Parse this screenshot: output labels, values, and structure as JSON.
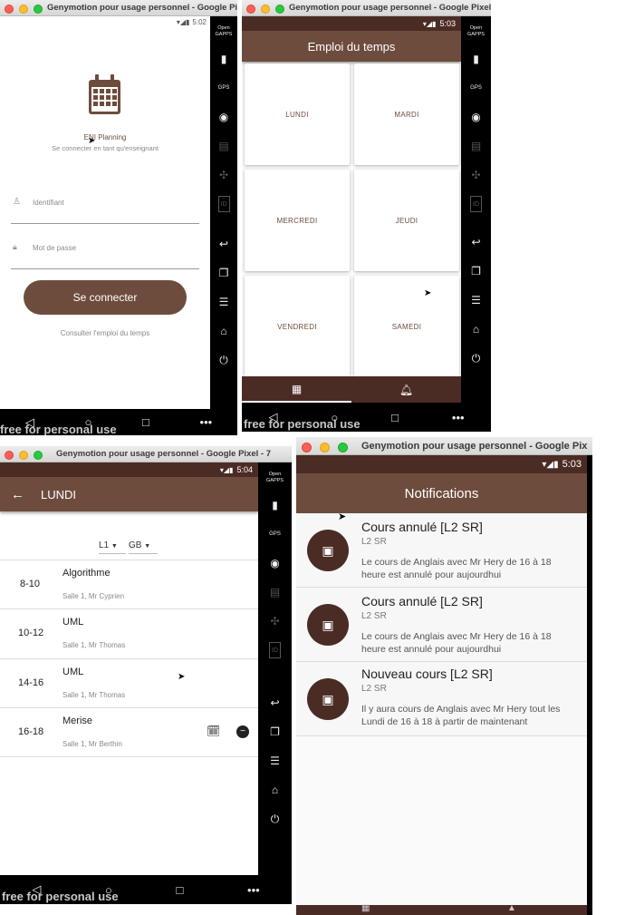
{
  "window_title": "Genymotion pour usage personnel - Google Pixel - 7",
  "window_title_short": "Genymotion pour usage personnel - Google Pix",
  "watermark": "free for personal use",
  "sidebar": {
    "opengapps_line1": "Open",
    "opengapps_line2": "GAPPS",
    "gps": "GPS",
    "id": "ID"
  },
  "login": {
    "time": "5:02",
    "app_name": "ENI Planning",
    "subtitle": "Se connecter en tant qu'enseignant",
    "username_placeholder": "Identifiant",
    "password_placeholder": "Mot de passe",
    "login_button": "Se connecter",
    "schedule_link": "Consulter l'emploi du temps"
  },
  "schedule": {
    "time": "5:03",
    "title": "Emploi du temps",
    "days": [
      "LUNDI",
      "MARDI",
      "MERCREDI",
      "JEUDI",
      "VENDREDI",
      "SAMEDI"
    ]
  },
  "day": {
    "time": "5:04",
    "title": "LUNDI",
    "level": "L1",
    "group": "GB",
    "courses": [
      {
        "time": "8-10",
        "name": "Algorithme",
        "detail": "Salle 1, Mr Cyprien"
      },
      {
        "time": "10-12",
        "name": "UML",
        "detail": "Salle 1, Mr Thomas"
      },
      {
        "time": "14-16",
        "name": "UML",
        "detail": "Salle 1, Mr Thomas"
      },
      {
        "time": "16-18",
        "name": "Merise",
        "detail": "Salle 1, Mr Berthin"
      }
    ]
  },
  "notifications": {
    "time": "5:03",
    "title": "Notifications",
    "items": [
      {
        "title": "Cours annulé [L2 SR]",
        "tag": "L2 SR",
        "body": "Le cours de Anglais avec Mr Hery de 16 à 18 heure est annulé pour aujourdhui"
      },
      {
        "title": "Cours annulé [L2 SR]",
        "tag": "L2 SR",
        "body": "Le cours de Anglais avec Mr Hery de 16 à 18 heure est annulé pour aujourdhui"
      },
      {
        "title": "Nouveau cours [L2 SR]",
        "tag": "L2 SR",
        "body": "Il y aura cours de Anglais avec Mr Hery tout les Lundi de 16 à 18 à partir de maintenant"
      }
    ]
  },
  "colors": {
    "primary": "#6e4c3d",
    "statusbar": "#4b2c24",
    "accent_brown": "#6e4c3d"
  }
}
